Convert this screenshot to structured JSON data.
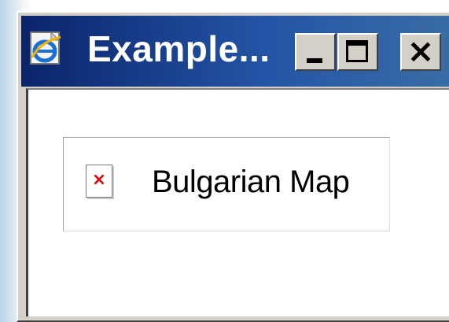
{
  "window": {
    "title": "Example...",
    "app_icon": "internet-explorer-icon",
    "controls": {
      "minimize_icon": "minimize-icon",
      "maximize_icon": "maximize-icon",
      "close_icon": "close-icon",
      "close_glyph": "×"
    },
    "colors": {
      "titlebar_start": "#0a246a",
      "titlebar_end": "#3a6ea5",
      "chrome": "#d4d0c8"
    }
  },
  "content": {
    "image_placeholder": {
      "alt_text": "Bulgarian Map",
      "icon": "broken-image-icon",
      "icon_glyph": "×",
      "icon_color": "#e00000"
    }
  }
}
